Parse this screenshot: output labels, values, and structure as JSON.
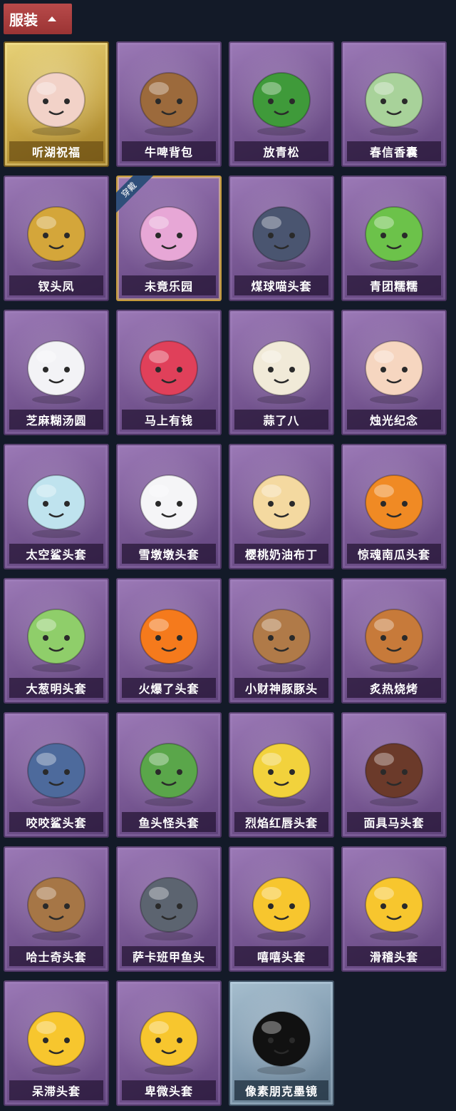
{
  "header": {
    "title": "服装"
  },
  "equipped_tag": "穿戴",
  "items": [
    {
      "name": "听湖祝福",
      "frame": "gold",
      "icon": "mannequin-wings-icon",
      "color": "#f2d2c8"
    },
    {
      "name": "牛啤背包",
      "frame": "purple",
      "icon": "beer-barrel-cow-icon",
      "color": "#9c6a3c"
    },
    {
      "name": "放青松",
      "frame": "purple",
      "icon": "potted-pine-icon",
      "color": "#3f9a3a"
    },
    {
      "name": "春信香囊",
      "frame": "purple",
      "icon": "green-sachet-icon",
      "color": "#a8d29a"
    },
    {
      "name": "钗头凤",
      "frame": "purple",
      "icon": "phoenix-crown-doll-icon",
      "color": "#d4a63a"
    },
    {
      "name": "未竟乐园",
      "frame": "purple",
      "icon": "pink-hair-doll-icon",
      "color": "#e7a7d6",
      "equipped": true
    },
    {
      "name": "煤球喵头套",
      "frame": "purple",
      "icon": "black-cat-head-icon",
      "color": "#4a5570"
    },
    {
      "name": "青团糯糯",
      "frame": "purple",
      "icon": "green-rice-ball-icon",
      "color": "#6cc24a"
    },
    {
      "name": "芝麻糊汤圆",
      "frame": "purple",
      "icon": "rice-dumpling-icon",
      "color": "#f3f3f6"
    },
    {
      "name": "马上有钱",
      "frame": "purple",
      "icon": "red-horse-icon",
      "color": "#e0405a"
    },
    {
      "name": "蒜了八",
      "frame": "purple",
      "icon": "garlic-icon",
      "color": "#f1ead8"
    },
    {
      "name": "烛光纪念",
      "frame": "purple",
      "icon": "candle-icon",
      "color": "#f6d6c0"
    },
    {
      "name": "太空鲨头套",
      "frame": "purple",
      "icon": "space-shark-icon",
      "color": "#bfe3ee"
    },
    {
      "name": "雪墩墩头套",
      "frame": "purple",
      "icon": "snowman-icon",
      "color": "#f5f5f7"
    },
    {
      "name": "樱桃奶油布丁",
      "frame": "purple",
      "icon": "pudding-icon",
      "color": "#f4d9a0"
    },
    {
      "name": "惊魂南瓜头套",
      "frame": "purple",
      "icon": "pumpkin-icon",
      "color": "#f08a24"
    },
    {
      "name": "大葱明头套",
      "frame": "purple",
      "icon": "scallion-icon",
      "color": "#8fce6a"
    },
    {
      "name": "火爆了头套",
      "frame": "purple",
      "icon": "fire-spirit-icon",
      "color": "#f57a1c"
    },
    {
      "name": "小财神豚豚头",
      "frame": "purple",
      "icon": "capybara-icon",
      "color": "#b07a48"
    },
    {
      "name": "炙热烧烤",
      "frame": "purple",
      "icon": "bbq-meat-icon",
      "color": "#c77a3a"
    },
    {
      "name": "咬咬鲨头套",
      "frame": "purple",
      "icon": "biting-shark-icon",
      "color": "#4d6a9c"
    },
    {
      "name": "鱼头怪头套",
      "frame": "purple",
      "icon": "fish-head-icon",
      "color": "#5aa64a"
    },
    {
      "name": "烈焰红唇头套",
      "frame": "purple",
      "icon": "yellow-mouse-sunglasses-icon",
      "color": "#f2d23c"
    },
    {
      "name": "面具马头套",
      "frame": "purple",
      "icon": "horse-mask-icon",
      "color": "#6b3a2a"
    },
    {
      "name": "哈士奇头套",
      "frame": "purple",
      "icon": "husky-sunglasses-icon",
      "color": "#a67646"
    },
    {
      "name": "萨卡班甲鱼头",
      "frame": "purple",
      "icon": "sacabambaspis-icon",
      "color": "#5c6470"
    },
    {
      "name": "嘻嘻头套",
      "frame": "purple",
      "icon": "grin-emoji-icon",
      "color": "#f7c62e"
    },
    {
      "name": "滑稽头套",
      "frame": "purple",
      "icon": "funny-emoji-icon",
      "color": "#f7c62e"
    },
    {
      "name": "呆滞头套",
      "frame": "purple",
      "icon": "dazed-emoji-icon",
      "color": "#f7c62e"
    },
    {
      "name": "卑微头套",
      "frame": "purple",
      "icon": "pleading-emoji-icon",
      "color": "#f7c62e"
    },
    {
      "name": "像素朋克墨镜",
      "frame": "blue",
      "icon": "pixel-sunglasses-icon",
      "color": "#111111"
    }
  ]
}
